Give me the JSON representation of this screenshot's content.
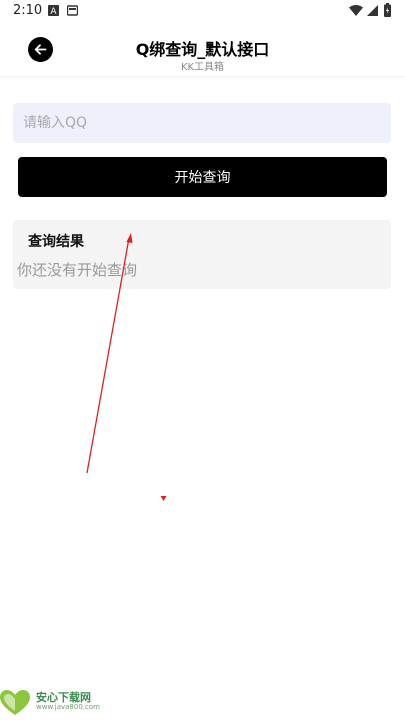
{
  "status_bar": {
    "time": "2:10",
    "icons": [
      "a-badge-icon",
      "message-icon",
      "wifi-icon",
      "signal-icon",
      "battery-icon"
    ]
  },
  "header": {
    "title": "Q绑查询_默认接口",
    "subtitle": "KK工具箱",
    "back_icon": "arrow-left-icon"
  },
  "form": {
    "input_value": "",
    "input_placeholder": "请输入QQ",
    "button_label": "开始查询"
  },
  "result": {
    "title": "查询结果",
    "empty_text": "你还没有开始查询"
  },
  "colors": {
    "accent": "#000000",
    "input_bg": "#eef0fb",
    "card_bg": "#f4f4f4",
    "annotation": "#e02020"
  },
  "watermark": {
    "name": "安心下载网",
    "url": "www.java800.com"
  }
}
